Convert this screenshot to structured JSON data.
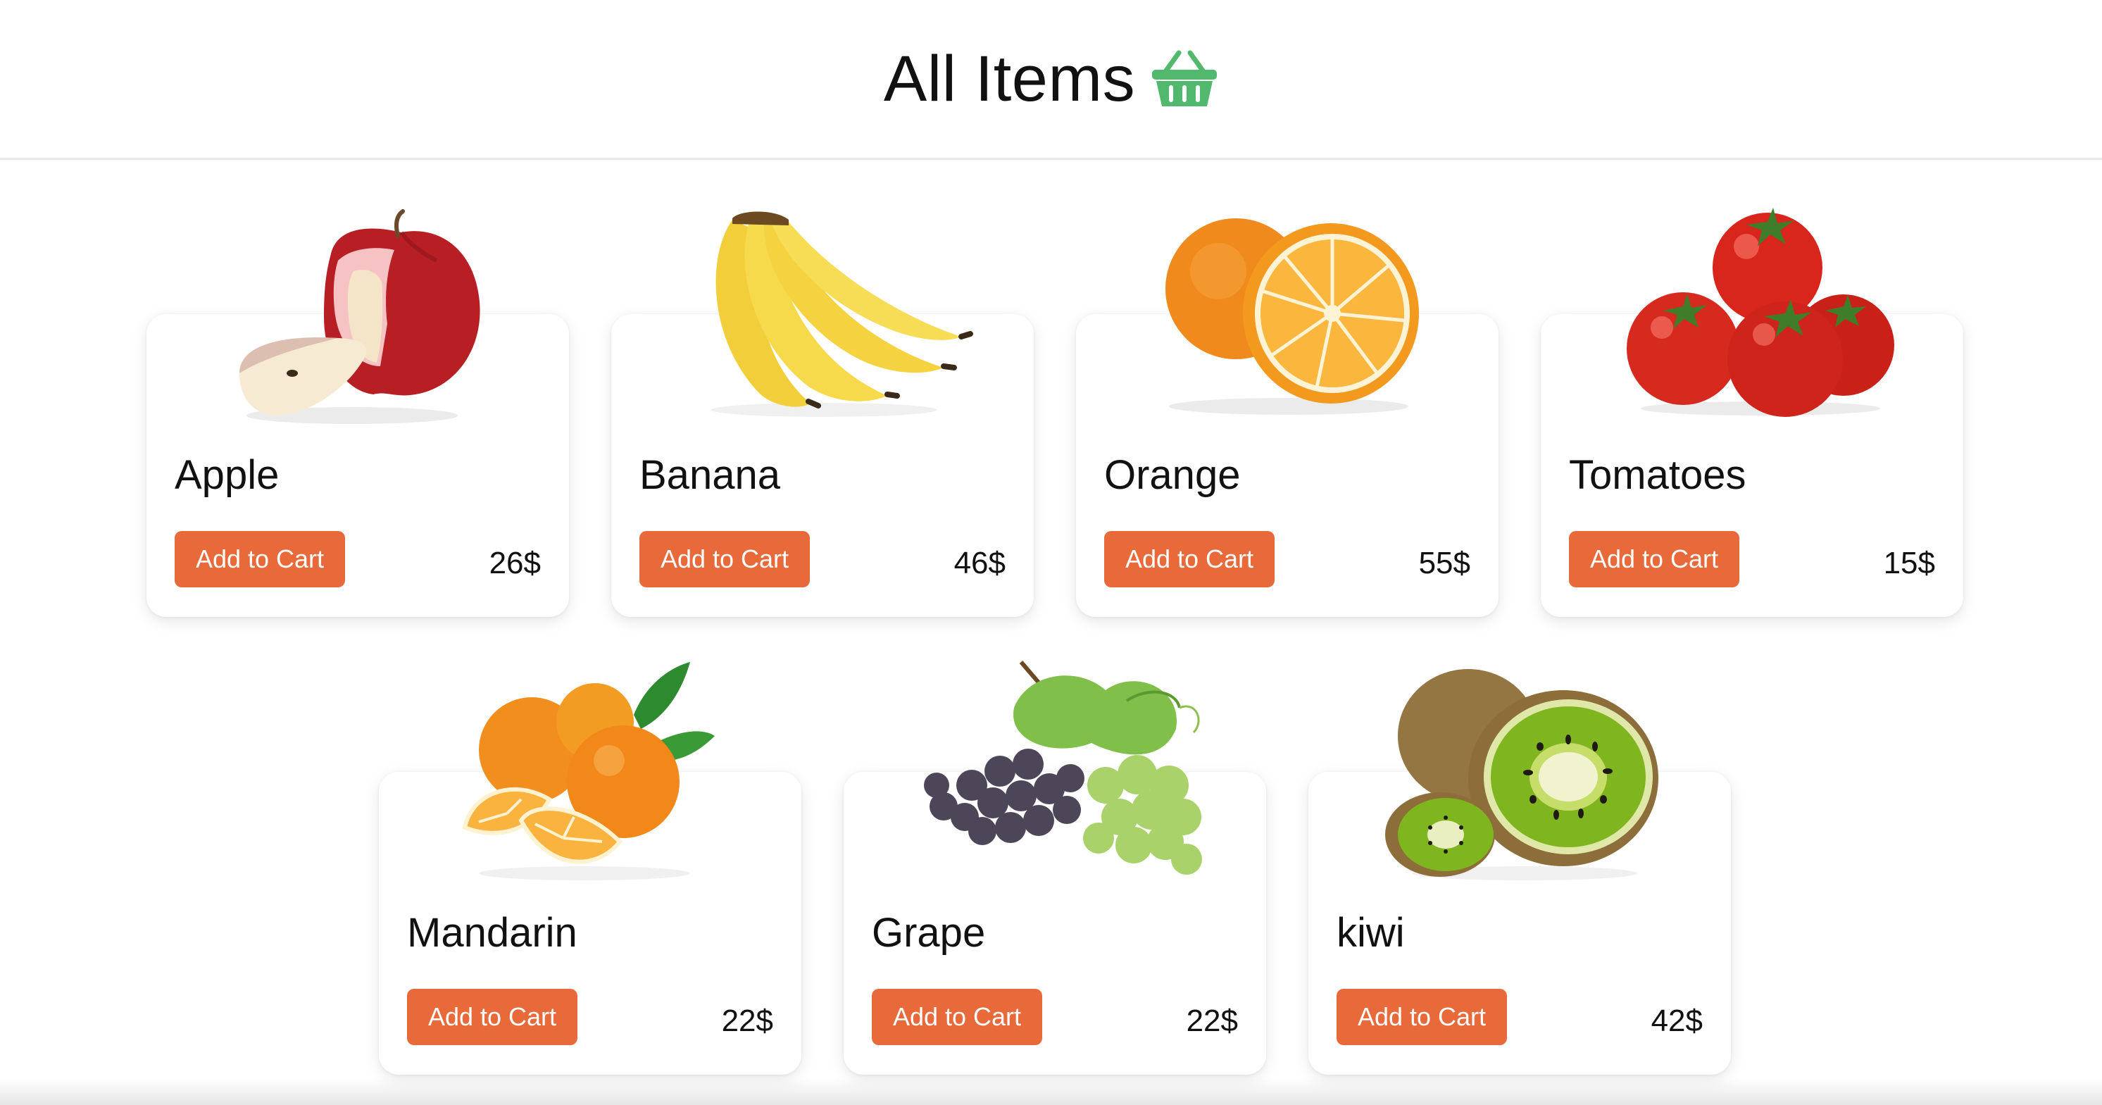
{
  "header": {
    "title": "All Items",
    "icon": "basket-icon",
    "icon_color": "#52b86e"
  },
  "accent_color": "#e8693a",
  "items": [
    {
      "name": "Apple",
      "button_label": "Add to Cart",
      "price": "26$",
      "image": "apple"
    },
    {
      "name": "Banana",
      "button_label": "Add to Cart",
      "price": "46$",
      "image": "banana"
    },
    {
      "name": "Orange",
      "button_label": "Add to Cart",
      "price": "55$",
      "image": "orange"
    },
    {
      "name": "Tomatoes",
      "button_label": "Add to Cart",
      "price": "15$",
      "image": "tomatoes"
    },
    {
      "name": "Mandarin",
      "button_label": "Add to Cart",
      "price": "22$",
      "image": "mandarin"
    },
    {
      "name": "Grape",
      "button_label": "Add to Cart",
      "price": "22$",
      "image": "grape"
    },
    {
      "name": "kiwi",
      "button_label": "Add to Cart",
      "price": "42$",
      "image": "kiwi"
    }
  ]
}
